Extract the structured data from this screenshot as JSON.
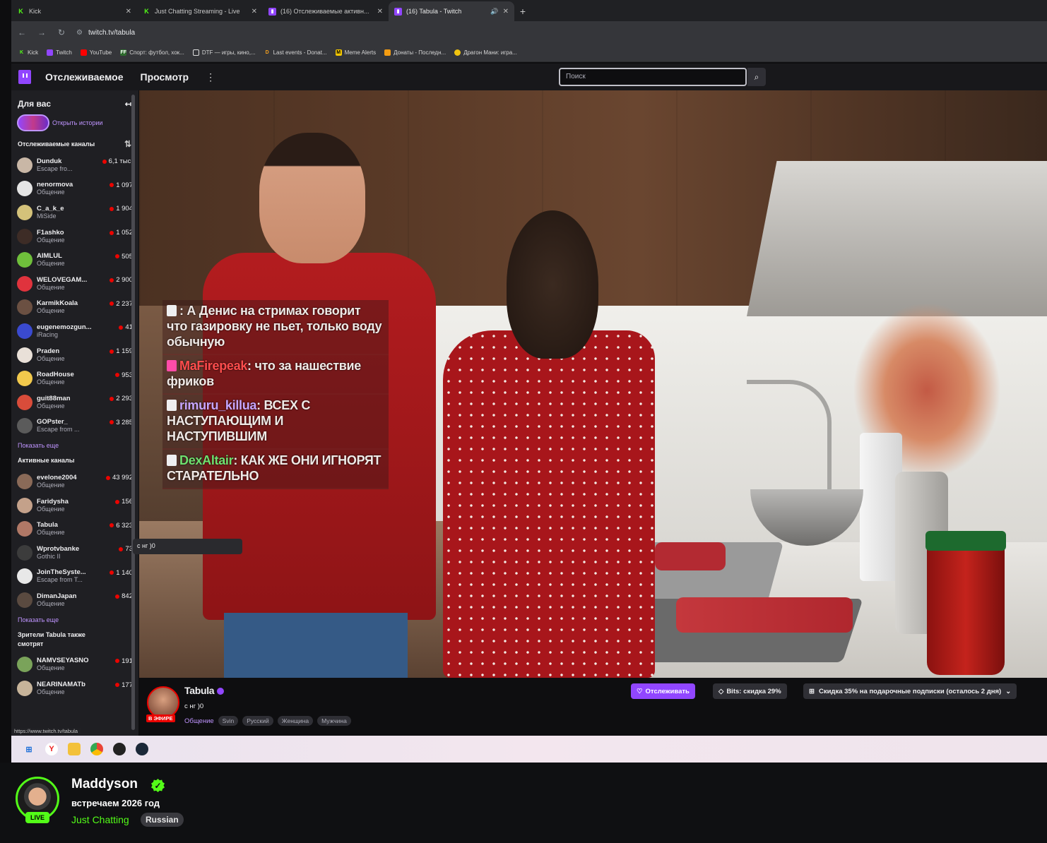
{
  "browser": {
    "tabs": [
      {
        "icon": "kick",
        "title": "Kick"
      },
      {
        "icon": "kick",
        "title": "Just Chatting Streaming - Live"
      },
      {
        "icon": "twitch",
        "title": "(16) Отслеживаемые активн..."
      },
      {
        "icon": "twitch",
        "title": "(16) Tabula - Twitch"
      }
    ],
    "url": "twitch.tv/tabula",
    "bookmarks": [
      "Kick",
      "Twitch",
      "YouTube",
      "Спорт: футбол, хок...",
      "DTF — игры, кино,...",
      "Last events - Donat...",
      "Meme Alerts",
      "Донаты - Последн...",
      "Драгон Мани: игра..."
    ]
  },
  "twitch": {
    "nav": {
      "following": "Отслеживаемое",
      "browse": "Просмотр",
      "more": "⋮"
    },
    "search_placeholder": "Поиск",
    "sidebar": {
      "for_you": "Для вас",
      "open_stories": "Открыть истории",
      "followed_title": "Отслеживаемые каналы",
      "followed": [
        {
          "name": "Dunduk",
          "cat": "Escape fro...",
          "viewers": "6,1 тыс.",
          "color": "#c9b7a6"
        },
        {
          "name": "nenormova",
          "cat": "Общение",
          "viewers": "1 097",
          "color": "#e5e5e5"
        },
        {
          "name": "C_a_k_e",
          "cat": "MiSide",
          "viewers": "1 904",
          "color": "#d4c27a"
        },
        {
          "name": "F1ashko",
          "cat": "Общение",
          "viewers": "1 052",
          "color": "#3d2c26"
        },
        {
          "name": "AIMLUL",
          "cat": "Общение",
          "viewers": "505",
          "color": "#6fbf3b"
        },
        {
          "name": "WELOVEGAM...",
          "cat": "Общение",
          "viewers": "2 900",
          "color": "#e0333d"
        },
        {
          "name": "KarmikKoala",
          "cat": "Общение",
          "viewers": "2 237",
          "color": "#6b5042"
        },
        {
          "name": "eugenemozgun...",
          "cat": "iRacing",
          "viewers": "41",
          "color": "#3a4ad0"
        },
        {
          "name": "Praden",
          "cat": "Общение",
          "viewers": "1 159",
          "color": "#e9e0d8"
        },
        {
          "name": "RoadHouse",
          "cat": "Общение",
          "viewers": "953",
          "color": "#f2c94c"
        },
        {
          "name": "guit88man",
          "cat": "Общение",
          "viewers": "2 293",
          "color": "#d94c3a"
        },
        {
          "name": "GOPster_",
          "cat": "Escape from ...",
          "viewers": "3 285",
          "color": "#5b5b5b"
        }
      ],
      "show_more": "Показать еще",
      "active_title": "Активные каналы",
      "active": [
        {
          "name": "evelone2004",
          "cat": "Общение",
          "viewers": "43 992",
          "color": "#8a6a58"
        },
        {
          "name": "Faridysha",
          "cat": "Общение",
          "viewers": "156",
          "color": "#c4a18a"
        },
        {
          "name": "Tabula",
          "cat": "Общение",
          "viewers": "6 323",
          "color": "#b07866"
        },
        {
          "name": "Wprotvbanke",
          "cat": "Gothic II",
          "viewers": "73",
          "color": "#3c3c3c"
        },
        {
          "name": "JoinTheSyste...",
          "cat": "Escape from T...",
          "viewers": "1 140",
          "color": "#e8e8e8"
        },
        {
          "name": "DimanJapan",
          "cat": "Общение",
          "viewers": "842",
          "color": "#5a4a40"
        }
      ],
      "show_more_2": "Показать еще",
      "also_title": "Зрители Tabula также смотрят",
      "also": [
        {
          "name": "NAMVSEYASNO",
          "cat": "Общение",
          "viewers": "191",
          "color": "#7aa35a"
        },
        {
          "name": "NEARINAMATb",
          "cat": "Общение",
          "viewers": "177",
          "color": "#c7b49a"
        }
      ],
      "status_url": "https://www.twitch.tv/tabula"
    },
    "tooltip": "с нг )0",
    "chat": [
      {
        "user": "",
        "text": ": А Денис на стримах говорит что газировку не пьет, только воду обычную",
        "color": "red"
      },
      {
        "user": "MaFirepeak",
        "text": ": что за нашествие фриков",
        "color": "red"
      },
      {
        "user": "rimuru_killua",
        "text": ": ВСЕХ С НАСТУПАЮЩИМ И НАСТУПИВШИМ",
        "color": "purple"
      },
      {
        "user": "DexAltair",
        "text": ": КАК ЖЕ ОНИ ИГНОРЯТ СТАРАТЕЛЬНО",
        "color": "green"
      }
    ],
    "channel": {
      "name": "Tabula",
      "live_badge": "В ЭФИРЕ",
      "title": "с нг )0",
      "category": "Общение",
      "tags": [
        "Svin",
        "Русский",
        "Женщина",
        "Мужчина"
      ],
      "follow": "Отслеживать",
      "bits": "Bits: скидка 29%",
      "gift": "Скидка 35% на подарочные подписки (осталось 2 дня)"
    }
  },
  "taskbar": [
    "windows",
    "yandex",
    "explorer",
    "chrome",
    "obs",
    "steam"
  ],
  "kick": {
    "streamer": "Maddyson",
    "live": "LIVE",
    "title": "встречаем 2026 год",
    "category": "Just Chatting",
    "language": "Russian"
  }
}
